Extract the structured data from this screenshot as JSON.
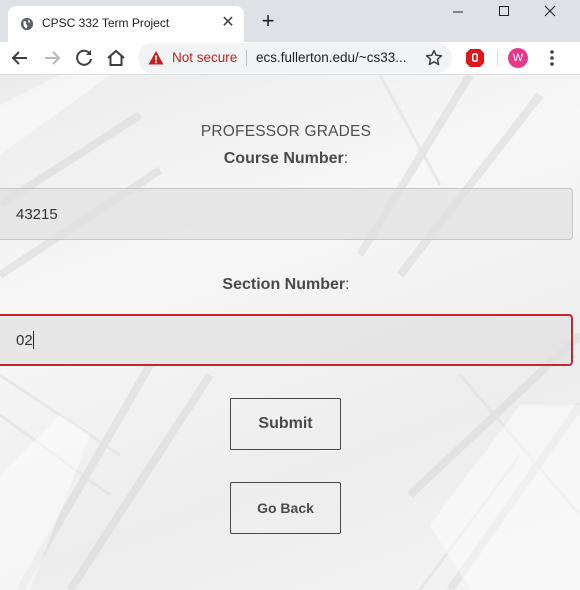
{
  "browser": {
    "tab_title": "CPSC 332 Term Project",
    "tab_icon": "globe-icon",
    "security_label": "Not secure",
    "url": "ecs.fullerton.edu/~cs33...",
    "profile_initial": "W",
    "colors": {
      "not_secure": "#c5221f",
      "avatar": "#e8388a",
      "extension": "#e0161b"
    }
  },
  "page": {
    "heading": "PROFESSOR GRADES",
    "course_label": "Course Number",
    "course_value": "43215",
    "section_label": "Section Number",
    "section_value": "02",
    "submit_label": "Submit",
    "back_label": "Go Back",
    "colors": {
      "focused_border": "#c4262e",
      "text": "#4a4a4a"
    }
  }
}
